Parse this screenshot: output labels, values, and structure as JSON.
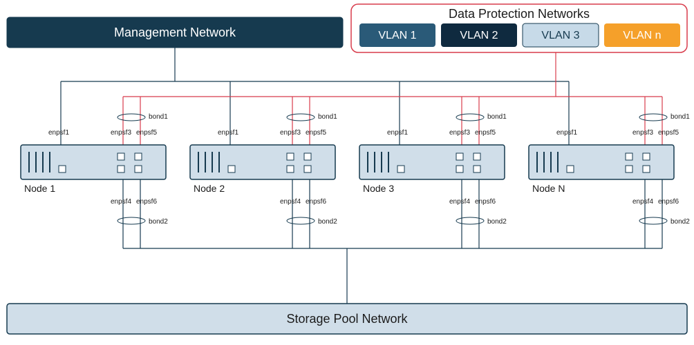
{
  "mgmt": {
    "label": "Management Network"
  },
  "dpn": {
    "title": "Data Protection Networks",
    "vlans": [
      "VLAN 1",
      "VLAN 2",
      "VLAN 3",
      "VLAN n"
    ]
  },
  "storage": {
    "label": "Storage Pool Network"
  },
  "nodes": {
    "labels": [
      "Node 1",
      "Node 2",
      "Node 3",
      "Node N"
    ],
    "iface_mgmt": "enpsf1",
    "iface_top_left": "enpsf3",
    "iface_top_right": "enpsf5",
    "iface_bot_left": "enpsf4",
    "iface_bot_right": "enpsf6",
    "bond_top": "bond1",
    "bond_bot": "bond2"
  },
  "chart_data": {
    "type": "network-topology",
    "networks": [
      {
        "name": "Management Network",
        "color": "#163A4F"
      },
      {
        "name": "Data Protection Networks",
        "vlans": [
          "VLAN 1",
          "VLAN 2",
          "VLAN 3",
          "VLAN n"
        ],
        "color": "#D83B4B"
      },
      {
        "name": "Storage Pool Network",
        "color": "#163A4F"
      }
    ],
    "nodes": [
      "Node 1",
      "Node 2",
      "Node 3",
      "Node N"
    ],
    "interfaces_per_node": {
      "management": "enpsf1",
      "bond1": [
        "enpsf3",
        "enpsf5"
      ],
      "bond2": [
        "enpsf4",
        "enpsf6"
      ]
    },
    "connections": [
      {
        "network": "Management Network",
        "target": "each-node",
        "iface": "enpsf1"
      },
      {
        "network": "Data Protection Networks",
        "target": "each-node",
        "bond": "bond1",
        "ifaces": [
          "enpsf3",
          "enpsf5"
        ]
      },
      {
        "network": "Storage Pool Network",
        "target": "each-node",
        "bond": "bond2",
        "ifaces": [
          "enpsf4",
          "enpsf6"
        ]
      }
    ]
  }
}
